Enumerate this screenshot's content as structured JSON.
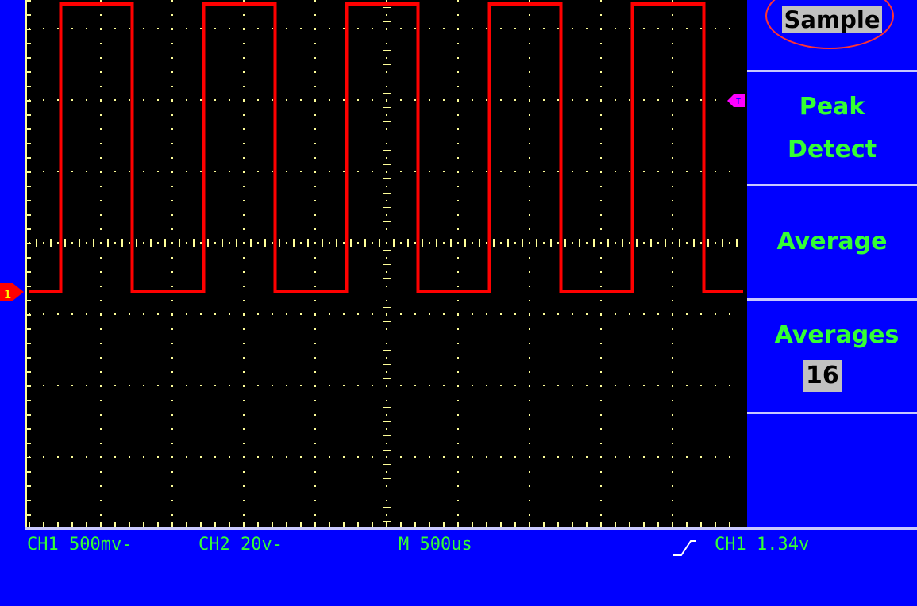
{
  "menu": {
    "sample": "Sample",
    "peak_detect_line1": "Peak",
    "peak_detect_line2": "Detect",
    "average": "Average",
    "averages_label": "Averages",
    "averages_value": "16"
  },
  "status": {
    "ch1_scale": "CH1 500mv-",
    "ch2_scale": "CH2 20v-",
    "timebase": "M 500us",
    "trigger": "CH1 1.34v"
  },
  "markers": {
    "ch1_marker": "1",
    "trigger_marker": "T"
  },
  "colors": {
    "background": "#0000ff",
    "screen": "#000000",
    "trace": "#ff0000",
    "text": "#33ff33",
    "grid": "#ffff99",
    "trigger_marker": "#ff00ff"
  },
  "waveform": {
    "type": "square",
    "high_level_div": 7.35,
    "low_level_div": 3.35,
    "period_div": 2.0,
    "duty": 0.5,
    "first_rise_div": 0.45
  }
}
